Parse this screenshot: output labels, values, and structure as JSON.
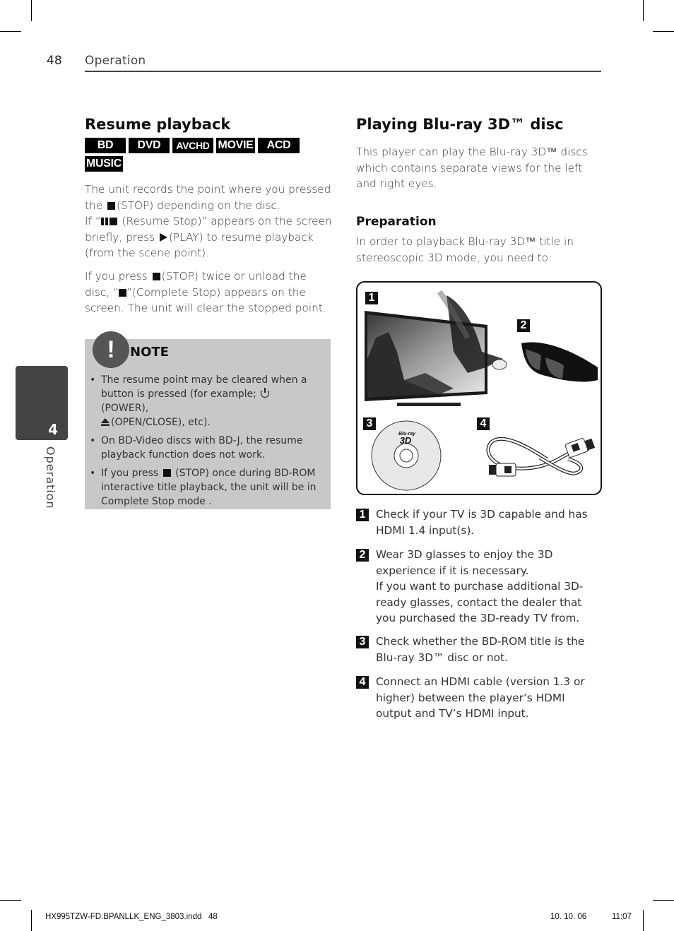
{
  "header": {
    "page_number": "48",
    "section": "Operation"
  },
  "side_tab": {
    "chapter_number": "4",
    "label": "Operation"
  },
  "resume": {
    "title": "Resume playback",
    "badges": [
      "BD",
      "DVD",
      "AVCHD",
      "MOVIE",
      "ACD",
      "MUSIC"
    ],
    "p1_a": "The unit records the point where you pressed the",
    "p1_b": "(STOP) depending on the disc.",
    "p1_c": "If “",
    "p1_d": " (Resume Stop)” appears on the screen briefly, press",
    "p1_e": "(PLAY) to resume playback (from the scene point).",
    "p2_a": "If you press",
    "p2_b": "(STOP) twice or unload the disc, “",
    "p2_c": "”(Complete Stop) appears on the screen. The unit will clear the stopped point."
  },
  "note": {
    "icon": "!",
    "title": "NOTE",
    "items": [
      {
        "a": "The resume point may be cleared when a button is pressed (for example;",
        "b": "(POWER),",
        "c": "(OPEN/CLOSE), etc)."
      },
      {
        "a": "On BD-Video discs with BD-J, the resume playback function does not work."
      },
      {
        "a": "If you press",
        "b": "(STOP) once during BD-ROM interactive title playback, the unit will be in Complete Stop mode ."
      }
    ]
  },
  "bluray": {
    "title": "Playing Blu-ray 3D™ disc",
    "intro": "This player can play the Blu-ray 3D™ discs which contains separate views for the left and right eyes.",
    "prep_title": "Preparation",
    "prep_text": "In order to playback Blu-ray 3D™ title in stereoscopic 3D mode, you need to:",
    "illustration": {
      "labels": [
        "1",
        "2",
        "3",
        "4"
      ],
      "disc_logo_top": "Blu-ray",
      "disc_logo_bottom": "3D"
    },
    "steps": [
      {
        "num": "1",
        "text": "Check if your TV is 3D capable and has HDMI 1.4 input(s)."
      },
      {
        "num": "2",
        "text": "Wear 3D glasses to enjoy the 3D experience if it is necessary.",
        "text2": "If you want to purchase additional 3D-ready glasses, contact the dealer that you purchased the 3D-ready TV from."
      },
      {
        "num": "3",
        "text": "Check whether the BD-ROM title is the Blu-ray 3D™ disc or not."
      },
      {
        "num": "4",
        "text": "Connect an HDMI cable (version 1.3 or higher) between the player’s HDMI output and TV’s HDMI input."
      }
    ]
  },
  "footer": {
    "file": "HX995TZW-FD.BPANLLK_ENG_3803.indd   48",
    "date": "10. 10. 06",
    "time": "11:07"
  }
}
